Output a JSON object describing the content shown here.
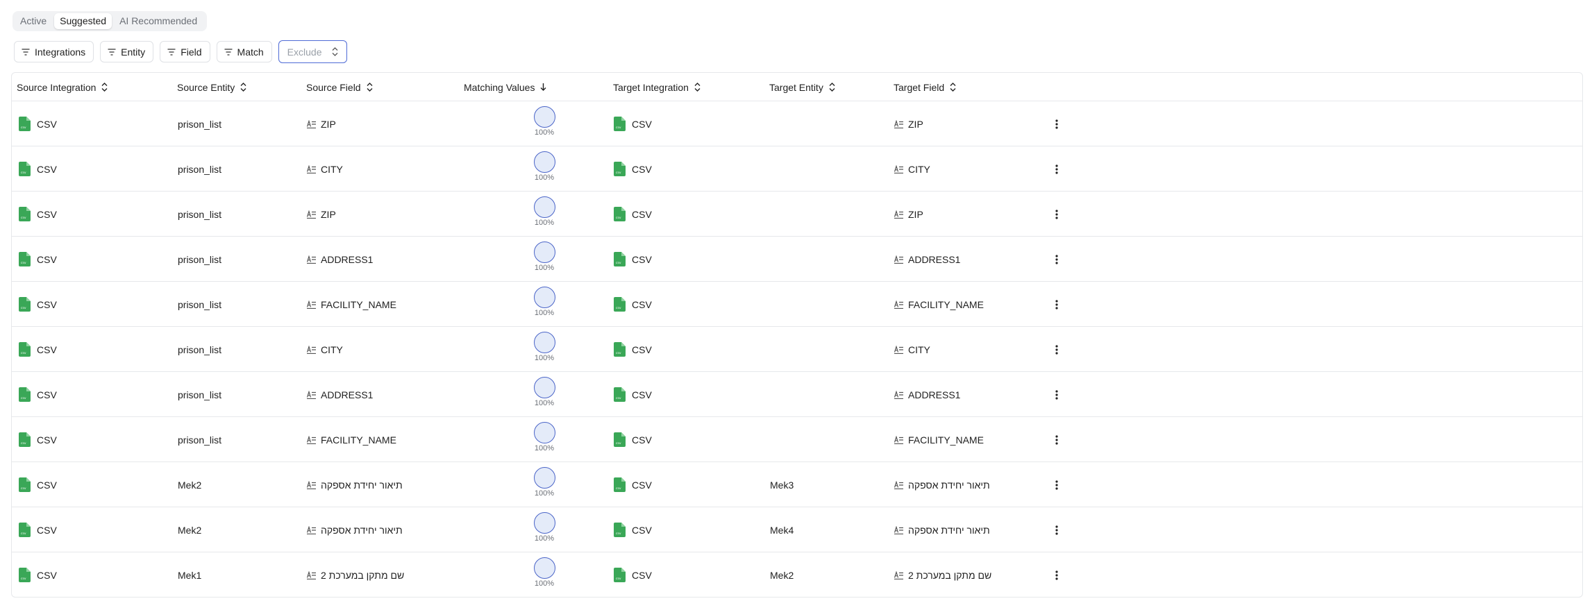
{
  "tabs": [
    {
      "label": "Active",
      "active": false
    },
    {
      "label": "Suggested",
      "active": true
    },
    {
      "label": "AI Recommended",
      "active": false
    }
  ],
  "filters": [
    "Integrations",
    "Entity",
    "Field",
    "Match"
  ],
  "exclude_placeholder": "Exclude",
  "columns": [
    {
      "label": "Source Integration",
      "sort": "both"
    },
    {
      "label": "Source Entity",
      "sort": "both"
    },
    {
      "label": "Source Field",
      "sort": "both"
    },
    {
      "label": "Matching Values",
      "sort": "desc"
    },
    {
      "label": "Target Integration",
      "sort": "both"
    },
    {
      "label": "Target Entity",
      "sort": "both"
    },
    {
      "label": "Target Field",
      "sort": "both"
    }
  ],
  "icons": {
    "csv": "csv-file-icon",
    "field": "text-field-icon",
    "menu": "kebab-menu-icon",
    "filter": "filter-icon",
    "sort": "sort-icon"
  },
  "colors": {
    "csv_green": "#3aa757",
    "match_circle_border": "#4a64c8",
    "match_circle_fill": "#e4ebf9",
    "exclude_border": "#4f6bd6"
  },
  "rows": [
    {
      "source_integration": "CSV",
      "source_entity": "prison_list",
      "source_field": "ZIP",
      "match": "100%",
      "target_integration": "CSV",
      "target_entity": "",
      "target_field": "ZIP"
    },
    {
      "source_integration": "CSV",
      "source_entity": "prison_list",
      "source_field": "CITY",
      "match": "100%",
      "target_integration": "CSV",
      "target_entity": "",
      "target_field": "CITY"
    },
    {
      "source_integration": "CSV",
      "source_entity": "prison_list",
      "source_field": "ZIP",
      "match": "100%",
      "target_integration": "CSV",
      "target_entity": "",
      "target_field": "ZIP"
    },
    {
      "source_integration": "CSV",
      "source_entity": "prison_list",
      "source_field": "ADDRESS1",
      "match": "100%",
      "target_integration": "CSV",
      "target_entity": "",
      "target_field": "ADDRESS1"
    },
    {
      "source_integration": "CSV",
      "source_entity": "prison_list",
      "source_field": "FACILITY_NAME",
      "match": "100%",
      "target_integration": "CSV",
      "target_entity": "",
      "target_field": "FACILITY_NAME"
    },
    {
      "source_integration": "CSV",
      "source_entity": "prison_list",
      "source_field": "CITY",
      "match": "100%",
      "target_integration": "CSV",
      "target_entity": "",
      "target_field": "CITY"
    },
    {
      "source_integration": "CSV",
      "source_entity": "prison_list",
      "source_field": "ADDRESS1",
      "match": "100%",
      "target_integration": "CSV",
      "target_entity": "",
      "target_field": "ADDRESS1"
    },
    {
      "source_integration": "CSV",
      "source_entity": "prison_list",
      "source_field": "FACILITY_NAME",
      "match": "100%",
      "target_integration": "CSV",
      "target_entity": "",
      "target_field": "FACILITY_NAME"
    },
    {
      "source_integration": "CSV",
      "source_entity": "Mek2",
      "source_field": "תיאור יחידת אספקה",
      "match": "100%",
      "target_integration": "CSV",
      "target_entity": "Mek3",
      "target_field": "תיאור יחידת אספקה"
    },
    {
      "source_integration": "CSV",
      "source_entity": "Mek2",
      "source_field": "תיאור יחידת אספקה",
      "match": "100%",
      "target_integration": "CSV",
      "target_entity": "Mek4",
      "target_field": "תיאור יחידת אספקה"
    },
    {
      "source_integration": "CSV",
      "source_entity": "Mek1",
      "source_field": "שם מתקן במערכת 2",
      "match": "100%",
      "target_integration": "CSV",
      "target_entity": "Mek2",
      "target_field": "שם מתקן במערכת 2"
    }
  ]
}
